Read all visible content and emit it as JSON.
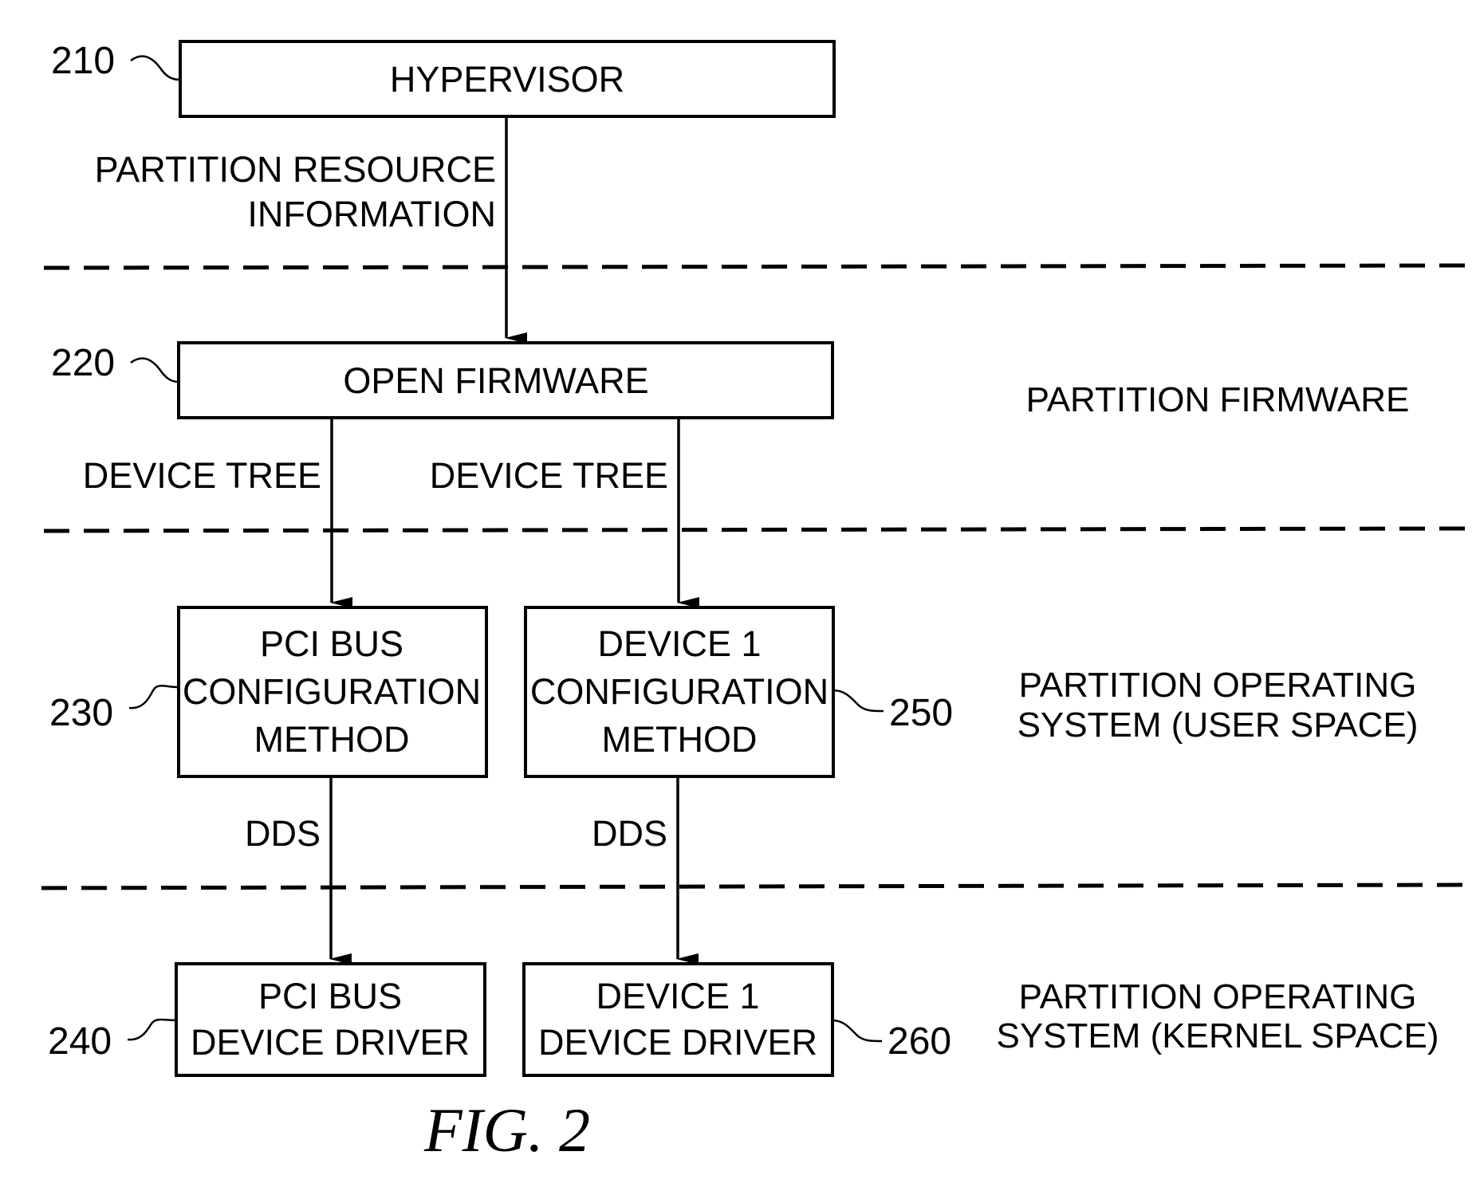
{
  "figure": {
    "caption": "FIG. 2"
  },
  "nodes": {
    "hypervisor": {
      "ref": "210",
      "lines": [
        "HYPERVISOR"
      ]
    },
    "open_firmware": {
      "ref": "220",
      "lines": [
        "OPEN FIRMWARE"
      ]
    },
    "pci_bus_config": {
      "ref": "230",
      "lines": [
        "PCI BUS",
        "CONFIGURATION",
        "METHOD"
      ]
    },
    "pci_bus_driver": {
      "ref": "240",
      "lines": [
        "PCI BUS",
        "DEVICE DRIVER"
      ]
    },
    "device1_config": {
      "ref": "250",
      "lines": [
        "DEVICE 1",
        "CONFIGURATION",
        "METHOD"
      ]
    },
    "device1_driver": {
      "ref": "260",
      "lines": [
        "DEVICE 1",
        "DEVICE DRIVER"
      ]
    }
  },
  "edges": {
    "hv_to_of": {
      "lines": [
        "PARTITION RESOURCE",
        "INFORMATION"
      ]
    },
    "of_to_pci": {
      "lines": [
        "DEVICE TREE"
      ]
    },
    "of_to_dev1": {
      "lines": [
        "DEVICE TREE"
      ]
    },
    "pci_cfg_to_drv": {
      "lines": [
        "DDS"
      ]
    },
    "dev1_cfg_to_drv": {
      "lines": [
        "DDS"
      ]
    }
  },
  "regions": {
    "firmware": {
      "lines": [
        "PARTITION FIRMWARE"
      ]
    },
    "user_space": {
      "lines": [
        "PARTITION OPERATING",
        "SYSTEM (USER SPACE)"
      ]
    },
    "kernel_space": {
      "lines": [
        "PARTITION OPERATING",
        "SYSTEM (KERNEL SPACE)"
      ]
    }
  }
}
